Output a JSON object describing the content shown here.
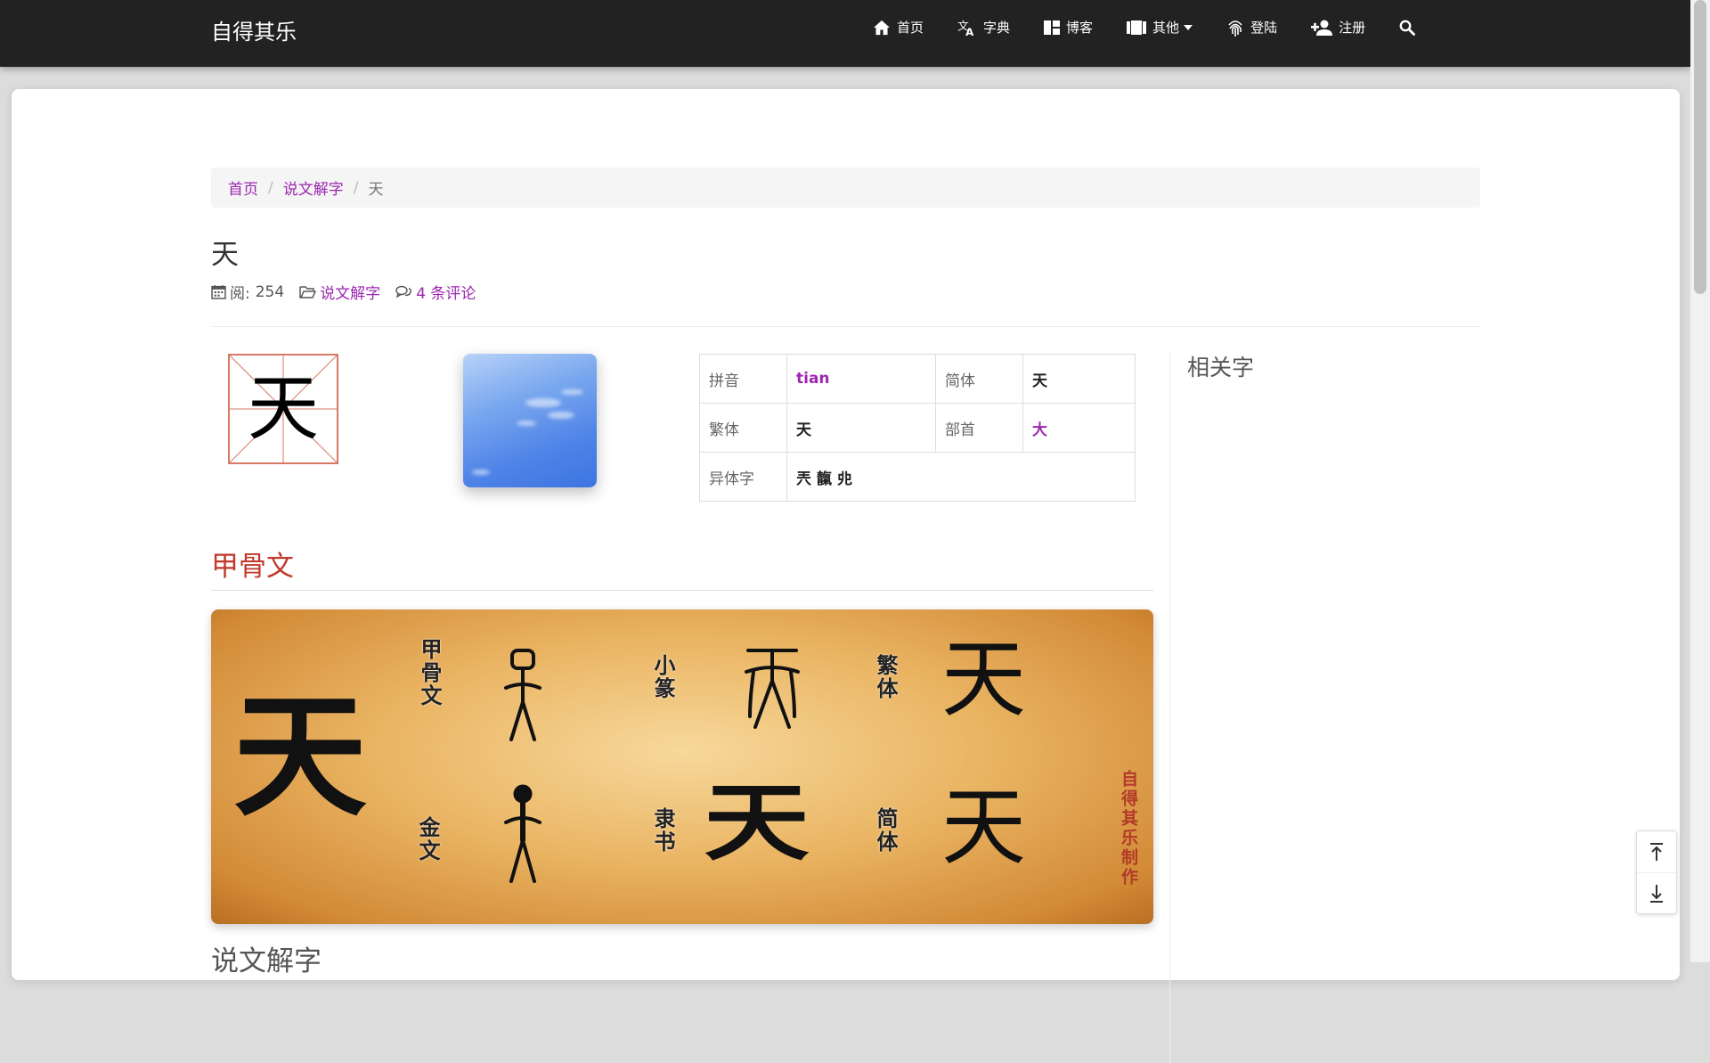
{
  "nav": {
    "brand": "自得其乐",
    "items": [
      {
        "label": "首页",
        "icon": "home-icon"
      },
      {
        "label": "字典",
        "icon": "translate-icon"
      },
      {
        "label": "博客",
        "icon": "dashboard-icon"
      },
      {
        "label": "其他",
        "icon": "video-icon"
      },
      {
        "label": "登陆",
        "icon": "fingerprint-icon"
      },
      {
        "label": "注册",
        "icon": "person-add-icon"
      }
    ],
    "search_icon": "search-icon"
  },
  "breadcrumb": {
    "home": "首页",
    "section": "说文解字",
    "current": "天"
  },
  "article": {
    "title": "天",
    "views_label": "阅:",
    "views": "254",
    "category": "说文解字",
    "comments": "4 条评论"
  },
  "character": {
    "glyph": "天"
  },
  "info_table": {
    "pinyin_label": "拼音",
    "pinyin": "tian",
    "simplified_label": "简体",
    "simplified": "天",
    "traditional_label": "繁体",
    "traditional": "天",
    "radical_label": "部首",
    "radical": "大",
    "variants_label": "异体字",
    "variants": "兲 靝 𠑹"
  },
  "sidebar": {
    "related_title": "相关字"
  },
  "section": {
    "oracle_title": "甲骨文",
    "shuowen_title": "说文解字"
  },
  "banner": {
    "big_char": "天",
    "oracle_label": "甲骨文",
    "bronze_label": "金文",
    "seal_label": "小篆",
    "clerical_label": "隶书",
    "traditional_label": "繁体",
    "simplified_label": "简体",
    "seal_char": "天",
    "clerical_char": "天",
    "traditional_char": "天",
    "simplified_char": "天",
    "stamp": "自得其乐制作"
  },
  "colors": {
    "accent": "#9c27b0",
    "section_title": "#c0392b",
    "navbar": "#222222"
  }
}
